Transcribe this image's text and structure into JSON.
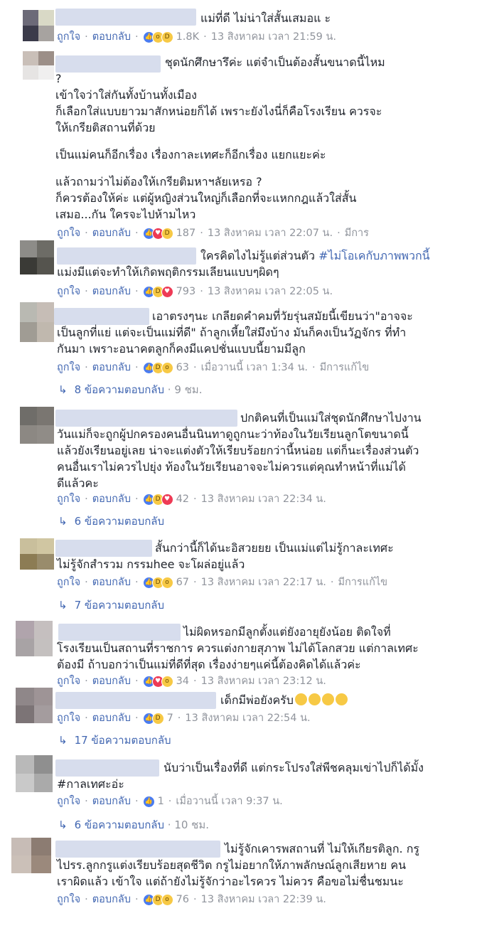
{
  "comments": [
    {
      "text_lines": [
        "แม่ที่ดี ไม่น่าใส่สั้นเสมอแ        ะ"
      ],
      "like": "ถูกใจ",
      "reply": "ตอบกลับ",
      "count": "1.8K",
      "time": "13 สิงหาคม เวลา 21:59 น.",
      "edited": "",
      "reactions": [
        "like",
        "wow",
        "haha"
      ]
    },
    {
      "text_lines": [
        "ชุดนักศึกษารึค่ะ แต่จำเป็นต้องสั้นขนาดนี้ไหม",
        "?",
        "เข้าใจว่าใส่กันทั้งบ้านทั้งเมือง",
        "ก็เลือกใส่แบบยาวมาสักหน่อยก็ได้ เพราะยังไงนี่ก็คือโรงเรียน ควรจะ",
        "ให้เกรียติสถานที่ด้วย",
        "",
        "เป็นแม่คนก็อีกเรื่อง เรื่องกาละเทศะก็อีกเรื่อง แยกแยะค่ะ",
        "",
        "แล้วถามว่าไม่ต้องให้เกรียติมหาฯลัยเหรอ ?",
        "ก็ควรต้องให้ค่ะ แต่ผู้หญิงส่วนใหญ่ก็เลือกที่จะแหกกฎแล้วใส่สั้น",
        "เสมอ...กัน ใครจะไปห้ามไหว"
      ],
      "like": "ถูกใจ",
      "reply": "ตอบกลับ",
      "count": "187",
      "time": "13 สิงหาคม เวลา 22:07 น.",
      "edited": "มีการ",
      "reactions": [
        "like",
        "love",
        "haha"
      ]
    },
    {
      "text_lines": [
        "ใครคิดไงไม่รู้แต่ส่วนตัว #ไม่โอเคกับภาพพวกนี้",
        "แม่งมีแต่จะทำให้เกิดพฤติกรรมเลียนแบบๆผิดๆ"
      ],
      "hashtag": "#ไม่โอเคกับภาพพวกนี้",
      "like": "ถูกใจ",
      "reply": "ตอบกลับ",
      "count": "793",
      "time": "13 สิงหาคม เวลา 22:05 น.",
      "edited": "",
      "reactions": [
        "like",
        "haha",
        "love"
      ]
    },
    {
      "text_lines": [
        "เอาตรงๆนะ เกลียดคำคมที่วัยรุ่นสมัยนี้เขียนว่า\"อาจจะ",
        "เป็นลูกที่แย่ แต่จะเป็นแม่ที่ดี\" ถ้าลูกเหี้ยใส่มึงบ้าง มันก็คงเป็นวัฏจักร ที่ทำ",
        "กันมา เพราะอนาคตลูกก็คงมีแคปชั่นแบบนี้ยามมีลูก"
      ],
      "like": "ถูกใจ",
      "reply": "ตอบกลับ",
      "count": "63",
      "time": "เมื่อวานนี้ เวลา 1:34 น.",
      "edited": "มีการแก้ไข",
      "reactions": [
        "like",
        "haha",
        "wow"
      ],
      "replies": "8 ข้อความตอบกลับ",
      "replies_time": "9 ชม."
    },
    {
      "text_lines": [
        "ปกติคนที่เป็นแม่ใส่ชุดนักศึกษาไปงาน",
        "วันแม่ก็จะถูกผู้ปกครองคนอื่นนินทาดูถูกนะว่าท้องในวัยเรียนลูกโตขนาดนี้",
        "แล้วยังเรียนอยู่เลย น่าจะแต่งตัวให้เรียบร้อยกว่านี้หน่อย แต่ก็นะเรื่องส่วนตัว",
        "คนอื่นเราไม่ควรไปยุ่ง ท้องในวัยเรียนอาจจะไม่ควรแต่คุณทำหน้าที่แม่ได้",
        "ดีแล้วคะ"
      ],
      "like": "ถูกใจ",
      "reply": "ตอบกลับ",
      "count": "42",
      "time": "13 สิงหาคม เวลา 22:34 น.",
      "edited": "",
      "reactions": [
        "like",
        "haha",
        "love"
      ],
      "replies": "6 ข้อความตอบกลับ",
      "replies_time": ""
    },
    {
      "text_lines": [
        "สั้นกว่านี้ก็ได้นะอิสวยยย เป็นแม่แต่ไม่รู้กาละเทศะ",
        "ไม่รู้จักสำรวม กรรมhee จะโผล่อยู่แล้ว"
      ],
      "like": "ถูกใจ",
      "reply": "ตอบกลับ",
      "count": "67",
      "time": "13 สิงหาคม เวลา 22:17 น.",
      "edited": "มีการแก้ไข",
      "reactions": [
        "like",
        "haha",
        "wow"
      ],
      "replies": "7 ข้อความตอบกลับ",
      "replies_time": ""
    },
    {
      "text_lines": [
        "ไม่ผิดหรอกมีลูกตั้งแต่ยังอายุยังน้อย ติดใจที่",
        "โรงเรียนเป็นสถานที่ราชการ ควรแต่งกายสุภาพ ไม่ได้โลกสวย แต่กาลเทศะ",
        "ต้องมี ถ้าบอกว่าเป็นแม่ที่ดีที่สุด เรื่องง่ายๆแค่นี้ต้องคิดได้แล้วค่ะ"
      ],
      "like": "ถูกใจ",
      "reply": "ตอบกลับ",
      "count": "34",
      "time": "13 สิงหาคม เวลา 23:12 น.",
      "edited": "",
      "reactions": [
        "like",
        "love",
        "wow"
      ]
    },
    {
      "text_lines": [
        "เด็กมีพ่อยังครับ"
      ],
      "emoji_count": 4,
      "like": "ถูกใจ",
      "reply": "ตอบกลับ",
      "count": "7",
      "time": "13 สิงหาคม เวลา 22:54 น.",
      "edited": "",
      "reactions": [
        "like",
        "haha"
      ],
      "replies": "17 ข้อความตอบกลับ",
      "replies_time": ""
    },
    {
      "text_lines": [
        "นับว่าเป็นเรื่องที่ดี แต่กระโปรงใส่พีชคลุมเข่าไปก็ได้มั้ง",
        "#กาลเทศะอ่ะ"
      ],
      "hashtag": "#กาลเทศะอ่ะ",
      "like": "ถูกใจ",
      "reply": "ตอบกลับ",
      "count": "1",
      "time": "เมื่อวานนี้ เวลา 9:37 น.",
      "edited": "",
      "reactions": [
        "like"
      ],
      "replies": "6 ข้อความตอบกลับ",
      "replies_time": "10 ชม."
    },
    {
      "text_lines": [
        "ไม่รู้จักเคารพสถานที่ ไม่ให้เกียรติลูก. กรู",
        "ไปรร.ลูกกรูแต่งเรียบร้อยสุดชีวิต กรูไม่อยากให้ภาพลักษณ์ลูกเสียหาย คน",
        "เราผิดแล้ว เข้าใจ แต่ถ้ายังไม่รู้จักว่าอะไรควร ไม่ควร คือขอไม่ชื่นชมนะ"
      ],
      "like": "ถูกใจ",
      "reply": "ตอบกลับ",
      "count": "76",
      "time": "13 สิงหาคม เวลา 22:39 น.",
      "edited": "",
      "reactions": [
        "like",
        "haha",
        "wow"
      ]
    }
  ],
  "colors": {
    "link": "#4267b2",
    "meta": "#90949c",
    "text": "#1d2129"
  }
}
